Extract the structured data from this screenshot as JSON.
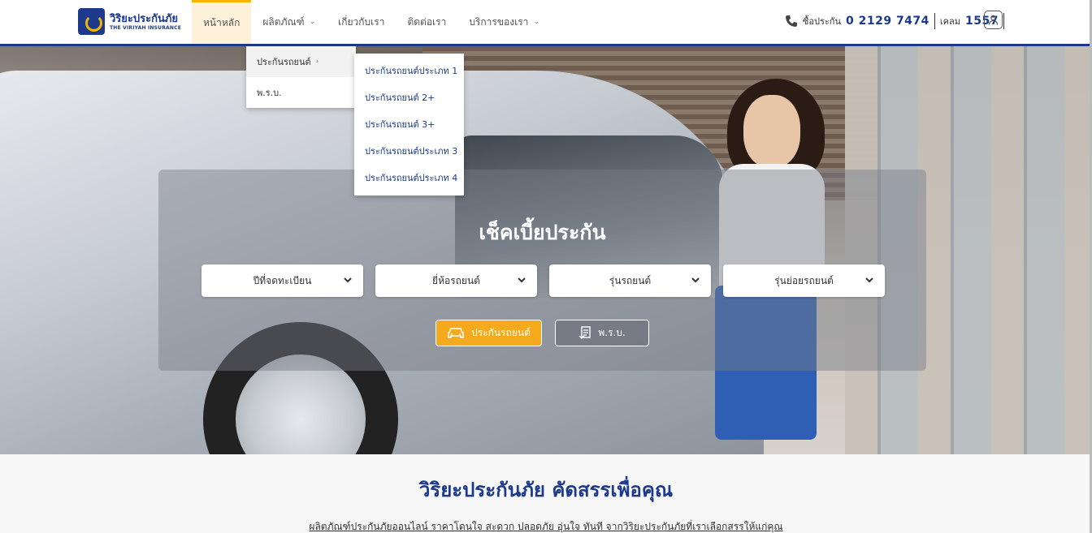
{
  "header": {
    "logo_th": "วิริยะประกันภัย",
    "logo_en": "THE VIRIYAH INSURANCE",
    "nav": [
      {
        "label": "หน้าหลัก",
        "active": true
      },
      {
        "label": "ผลิตภัณฑ์",
        "has_dropdown": true
      },
      {
        "label": "เกี่ยวกับเรา"
      },
      {
        "label": "ติดต่อเรา"
      },
      {
        "label": "บริการของเรา",
        "has_dropdown": true
      }
    ],
    "buy_label": "ซื้อประกัน",
    "buy_number": "0 2129 7474",
    "claim_label": "เคลม",
    "claim_number": "1557",
    "icons": {
      "phone": "phone-icon",
      "user": "user-icon"
    }
  },
  "product_menu": {
    "items": [
      {
        "label": "ประกันรถยนต์",
        "has_submenu": true
      },
      {
        "label": "พ.ร.บ."
      }
    ],
    "submenu": [
      "ประกันรถยนต์ประเภท 1",
      "ประกันรถยนต์ 2+",
      "ประกันรถยนต์ 3+",
      "ประกันรถยนต์ประเภท 3",
      "ประกันรถยนต์ประเภท 4"
    ]
  },
  "search": {
    "title": "เช็คเบี้ยประกัน",
    "selects": [
      "ปีที่จดทะเบียน",
      "ยี่ห้อรถยนต์",
      "รุ่นรถยนต์",
      "รุ่นย่อยรถยนต์"
    ],
    "buttons": {
      "car": "ประกันรถยนต์",
      "prb": "พ.ร.บ."
    }
  },
  "lower": {
    "title": "วิริยะประกันภัย คัดสรรเพื่อคุณ",
    "description": "ผลิตภัณฑ์ประกันภัยออนไลน์ ราคาโดนใจ สะดวก ปลอดภัย อุ่นใจ ทันที จากวิริยะประกันภัยที่เราเลือกสรรให้แก่คุณ"
  },
  "colors": {
    "brand": "#1b3a8c",
    "accent": "#f4aa1c"
  }
}
